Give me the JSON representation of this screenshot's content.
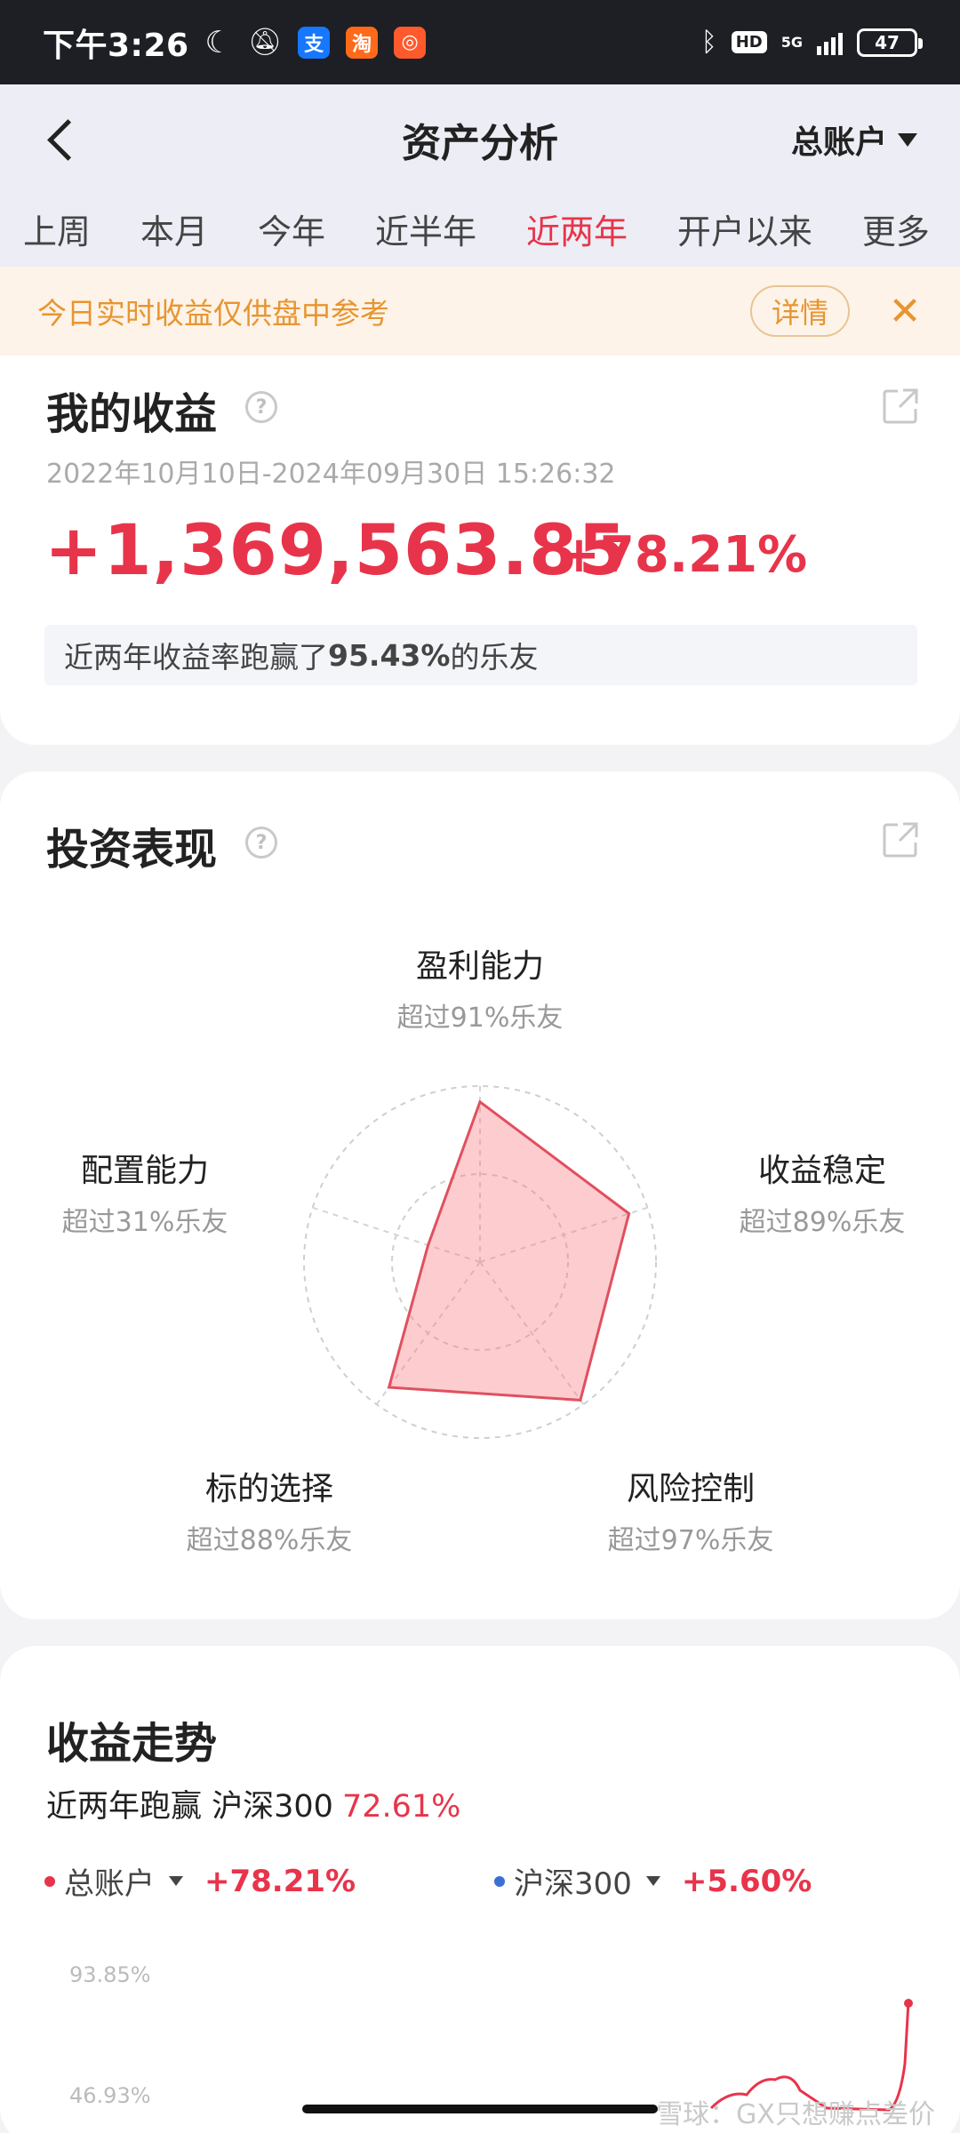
{
  "status_bar": {
    "time": "下午3:26",
    "network": "5G",
    "hd": "HD",
    "battery": "47"
  },
  "header": {
    "title": "资产分析",
    "account": "总账户",
    "tabs": [
      "上周",
      "本月",
      "今年",
      "近半年",
      "近两年",
      "开户以来",
      "更多"
    ],
    "active_tab": "近两年"
  },
  "notice": {
    "text": "今日实时收益仅供盘中参考",
    "button": "详情"
  },
  "earnings": {
    "title": "我的收益",
    "date_range": "2022年10月10日-2024年09月30日 15:26:32",
    "amount": "+1,369,563.85",
    "percent": "+78.21%",
    "beat_prefix": "近两年收益率跑赢了",
    "beat_value": "95.43%",
    "beat_suffix": "的乐友"
  },
  "performance": {
    "title": "投资表现",
    "dimensions": [
      {
        "label": "盈利能力",
        "sub": "超过91%乐友",
        "value": 91
      },
      {
        "label": "收益稳定",
        "sub": "超过89%乐友",
        "value": 89
      },
      {
        "label": "风险控制",
        "sub": "超过97%乐友",
        "value": 97
      },
      {
        "label": "标的选择",
        "sub": "超过88%乐友",
        "value": 88
      },
      {
        "label": "配置能力",
        "sub": "超过31%乐友",
        "value": 31
      }
    ]
  },
  "trend": {
    "title": "收益走势",
    "sub_prefix": "近两年跑赢 沪深300",
    "sub_pct": "72.61%",
    "legend": [
      {
        "name": "总账户",
        "value": "+78.21%",
        "color": "#e8344a"
      },
      {
        "name": "沪深300",
        "value": "+5.60%",
        "color": "#3a6fd8"
      }
    ],
    "y_ticks": [
      "93.85%",
      "46.93%"
    ]
  },
  "watermark": "雪球：GX只想赚点差价",
  "colors": {
    "accent": "#e8344a",
    "notice": "#e89530",
    "blue": "#3a6fd8"
  }
}
